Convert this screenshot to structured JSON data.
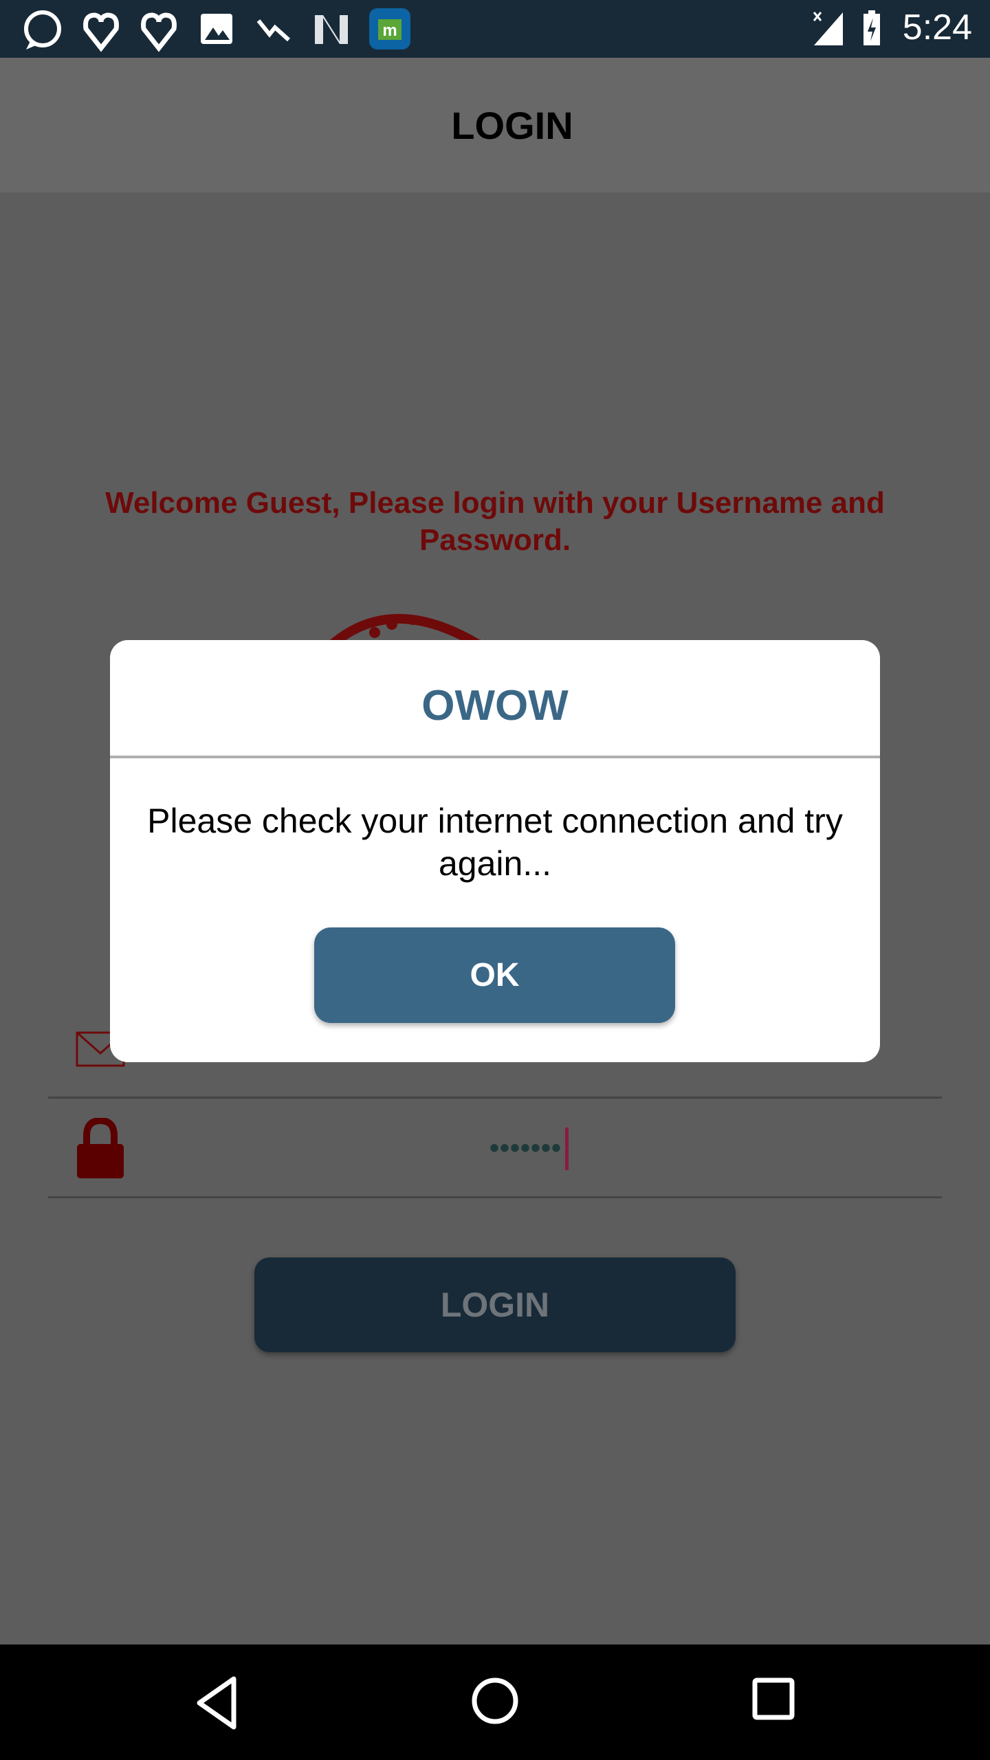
{
  "status_bar": {
    "time": "5:24",
    "icons": [
      "whatsapp-icon",
      "heart-icon",
      "heart-icon",
      "image-icon",
      "trending-down-icon",
      "n-app-icon",
      "m-app-icon",
      "signal-icon",
      "battery-charging-icon"
    ]
  },
  "app_bar": {
    "title": "LOGIN"
  },
  "welcome": {
    "text": "Welcome Guest, Please login with your Username and Password."
  },
  "form": {
    "password_value": "•••••••",
    "login_label": "LOGIN"
  },
  "dialog": {
    "title": "OWOW",
    "message": "Please check your internet connection and try again...",
    "ok_label": "OK"
  },
  "colors": {
    "accent": "#3b6787",
    "status_bar": "#182a38",
    "brand_red": "#8b0000"
  }
}
